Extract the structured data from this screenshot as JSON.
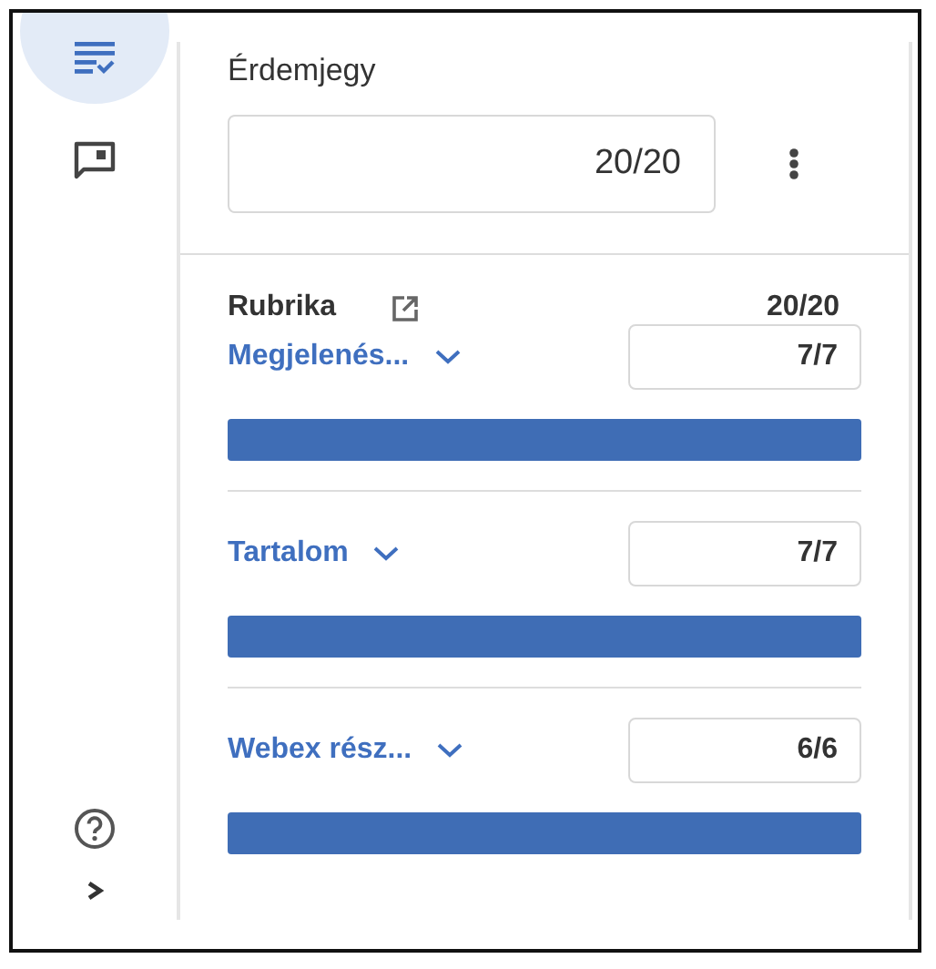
{
  "rail": {
    "items": [
      {
        "kind": "rubric",
        "selected": true
      },
      {
        "kind": "comment",
        "selected": false
      }
    ],
    "help": {
      "kind": "help"
    },
    "expand": {
      "kind": "expand"
    }
  },
  "grade": {
    "title": "Érdemjegy",
    "value": "20/20"
  },
  "rubric": {
    "title": "Rubrika",
    "total": "20/20",
    "criteria": [
      {
        "name": "Megjelenés...",
        "score": "7/7"
      },
      {
        "name": "Tartalom",
        "score": "7/7"
      },
      {
        "name": "Webex rész...",
        "score": "6/6"
      }
    ]
  }
}
